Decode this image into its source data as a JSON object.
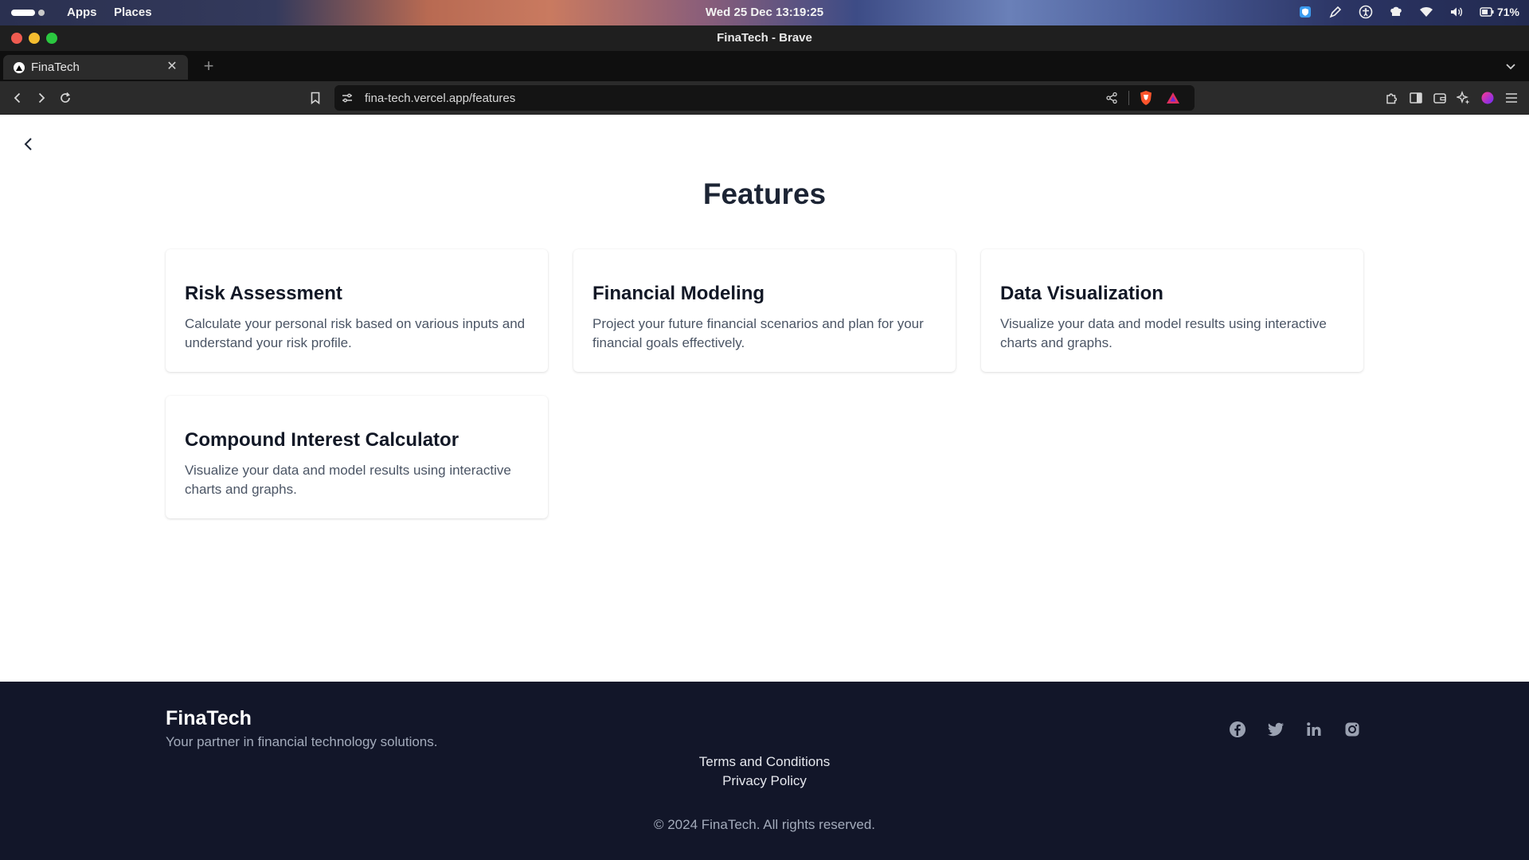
{
  "system_bar": {
    "menu_apps": "Apps",
    "menu_places": "Places",
    "clock": "Wed 25 Dec  13:19:25",
    "battery": "71%",
    "icons": [
      "shield-app-icon",
      "pen-icon",
      "accessibility-icon",
      "chef-hat-icon",
      "wifi-icon",
      "volume-icon",
      "battery-icon"
    ]
  },
  "window": {
    "title": "FinaTech - Brave"
  },
  "tabs": [
    {
      "label": "FinaTech",
      "active": true
    }
  ],
  "toolbar": {
    "url": "fina-tech.vercel.app/features"
  },
  "page": {
    "title": "Features",
    "cards": [
      {
        "title": "Risk Assessment",
        "description": "Calculate your personal risk based on various inputs and understand your risk profile."
      },
      {
        "title": "Financial Modeling",
        "description": "Project your future financial scenarios and plan for your financial goals effectively."
      },
      {
        "title": "Data Visualization",
        "description": "Visualize your data and model results using interactive charts and graphs."
      },
      {
        "title": "Compound Interest Calculator",
        "description": "Visualize your data and model results using interactive charts and graphs."
      }
    ]
  },
  "footer": {
    "brand": "FinaTech",
    "tagline": "Your partner in financial technology solutions.",
    "links": [
      "Terms and Conditions",
      "Privacy Policy"
    ],
    "copyright": "© 2024 FinaTech. All rights reserved.",
    "socials": [
      "facebook-icon",
      "twitter-icon",
      "linkedin-icon",
      "instagram-icon"
    ]
  },
  "colors": {
    "heading": "#1c2434",
    "footer_bg": "#121629",
    "muted_text": "#4b5565"
  }
}
